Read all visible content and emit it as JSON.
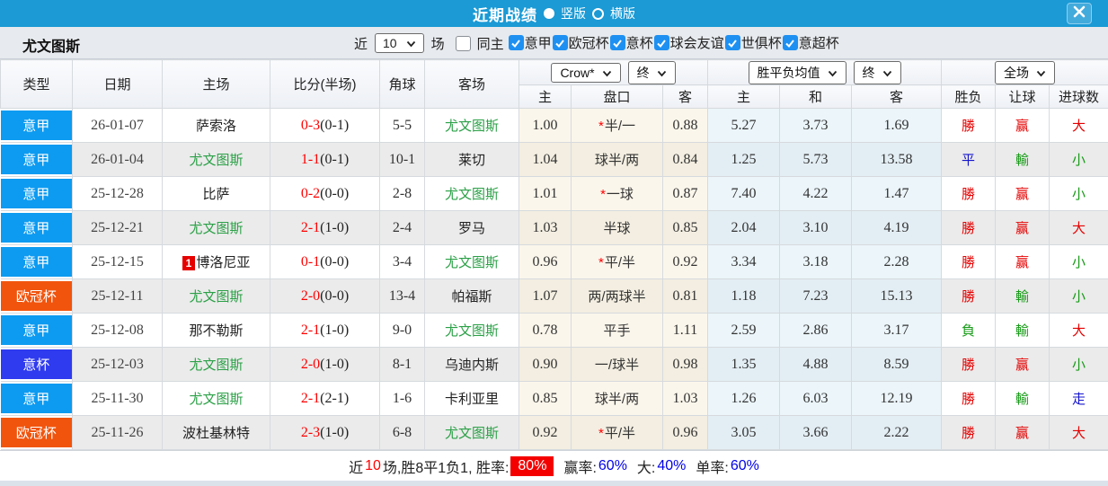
{
  "titlebar": {
    "title": "近期战绩",
    "vertical_label": "竖版",
    "horizontal_label": "横版",
    "vertical_selected": true
  },
  "filterbar": {
    "team": "尤文图斯",
    "near_label": "近",
    "match_count": "10",
    "field_label": "场",
    "same_home_label": "同主",
    "same_home_checked": false,
    "leagues": [
      {
        "label": "意甲",
        "checked": true
      },
      {
        "label": "欧冠杯",
        "checked": true
      },
      {
        "label": "意杯",
        "checked": true
      },
      {
        "label": "球会友谊",
        "checked": true
      },
      {
        "label": "世俱杯",
        "checked": true
      },
      {
        "label": "意超杯",
        "checked": true
      }
    ]
  },
  "table": {
    "headers": {
      "type": "类型",
      "date": "日期",
      "home": "主场",
      "score": "比分(半场)",
      "corner": "角球",
      "away": "客场",
      "sub_odds_home": "主",
      "sub_handicap": "盘口",
      "sub_odds_away": "客",
      "sub_avg_home": "主",
      "sub_avg_draw": "和",
      "sub_avg_away": "客",
      "sub_result": "胜负",
      "sub_handicap_result": "让球",
      "sub_goals": "进球数"
    },
    "dropdowns": {
      "odds_source": "Crow*",
      "final1": "终",
      "avg": "胜平负均值",
      "final2": "终",
      "scope": "全场"
    },
    "rows": [
      {
        "league": "意甲",
        "league_color": "serie_a",
        "date": "26-01-07",
        "home": "萨索洛",
        "home_green": false,
        "home_rank": "",
        "score": "0-3",
        "half": "(0-1)",
        "corner": "5-5",
        "away": "尤文图斯",
        "away_green": true,
        "odds_home": "1.00",
        "handicap": "半/一",
        "handicap_star": true,
        "odds_away": "0.88",
        "avg_home": "5.27",
        "avg_draw": "3.73",
        "avg_away": "1.69",
        "result": "勝",
        "result_color": "red",
        "handicap_result": "赢",
        "handicap_result_color": "red",
        "goals": "大",
        "goals_color": "red"
      },
      {
        "league": "意甲",
        "league_color": "serie_a",
        "date": "26-01-04",
        "home": "尤文图斯",
        "home_green": true,
        "home_rank": "",
        "score": "1-1",
        "half": "(0-1)",
        "corner": "10-1",
        "away": "莱切",
        "away_green": false,
        "odds_home": "1.04",
        "handicap": "球半/两",
        "handicap_star": false,
        "odds_away": "0.84",
        "avg_home": "1.25",
        "avg_draw": "5.73",
        "avg_away": "13.58",
        "result": "平",
        "result_color": "blue",
        "handicap_result": "輸",
        "handicap_result_color": "green",
        "goals": "小",
        "goals_color": "green"
      },
      {
        "league": "意甲",
        "league_color": "serie_a",
        "date": "25-12-28",
        "home": "比萨",
        "home_green": false,
        "home_rank": "",
        "score": "0-2",
        "half": "(0-0)",
        "corner": "2-8",
        "away": "尤文图斯",
        "away_green": true,
        "odds_home": "1.01",
        "handicap": "一球",
        "handicap_star": true,
        "odds_away": "0.87",
        "avg_home": "7.40",
        "avg_draw": "4.22",
        "avg_away": "1.47",
        "result": "勝",
        "result_color": "red",
        "handicap_result": "赢",
        "handicap_result_color": "red",
        "goals": "小",
        "goals_color": "green"
      },
      {
        "league": "意甲",
        "league_color": "serie_a",
        "date": "25-12-21",
        "home": "尤文图斯",
        "home_green": true,
        "home_rank": "",
        "score": "2-1",
        "half": "(1-0)",
        "corner": "2-4",
        "away": "罗马",
        "away_green": false,
        "odds_home": "1.03",
        "handicap": "半球",
        "handicap_star": false,
        "odds_away": "0.85",
        "avg_home": "2.04",
        "avg_draw": "3.10",
        "avg_away": "4.19",
        "result": "勝",
        "result_color": "red",
        "handicap_result": "赢",
        "handicap_result_color": "red",
        "goals": "大",
        "goals_color": "red"
      },
      {
        "league": "意甲",
        "league_color": "serie_a",
        "date": "25-12-15",
        "home": "博洛尼亚",
        "home_green": false,
        "home_rank": "1",
        "score": "0-1",
        "half": "(0-0)",
        "corner": "3-4",
        "away": "尤文图斯",
        "away_green": true,
        "odds_home": "0.96",
        "handicap": "平/半",
        "handicap_star": true,
        "odds_away": "0.92",
        "avg_home": "3.34",
        "avg_draw": "3.18",
        "avg_away": "2.28",
        "result": "勝",
        "result_color": "red",
        "handicap_result": "赢",
        "handicap_result_color": "red",
        "goals": "小",
        "goals_color": "green"
      },
      {
        "league": "欧冠杯",
        "league_color": "ucl",
        "date": "25-12-11",
        "home": "尤文图斯",
        "home_green": true,
        "home_rank": "",
        "score": "2-0",
        "half": "(0-0)",
        "corner": "13-4",
        "away": "帕福斯",
        "away_green": false,
        "odds_home": "1.07",
        "handicap": "两/两球半",
        "handicap_star": false,
        "odds_away": "0.81",
        "avg_home": "1.18",
        "avg_draw": "7.23",
        "avg_away": "15.13",
        "result": "勝",
        "result_color": "red",
        "handicap_result": "輸",
        "handicap_result_color": "green",
        "goals": "小",
        "goals_color": "green"
      },
      {
        "league": "意甲",
        "league_color": "serie_a",
        "date": "25-12-08",
        "home": "那不勒斯",
        "home_green": false,
        "home_rank": "",
        "score": "2-1",
        "half": "(1-0)",
        "corner": "9-0",
        "away": "尤文图斯",
        "away_green": true,
        "odds_home": "0.78",
        "handicap": "平手",
        "handicap_star": false,
        "odds_away": "1.11",
        "avg_home": "2.59",
        "avg_draw": "2.86",
        "avg_away": "3.17",
        "result": "負",
        "result_color": "green",
        "handicap_result": "輸",
        "handicap_result_color": "green",
        "goals": "大",
        "goals_color": "red"
      },
      {
        "league": "意杯",
        "league_color": "coppa",
        "date": "25-12-03",
        "home": "尤文图斯",
        "home_green": true,
        "home_rank": "",
        "score": "2-0",
        "half": "(1-0)",
        "corner": "8-1",
        "away": "乌迪内斯",
        "away_green": false,
        "odds_home": "0.90",
        "handicap": "一/球半",
        "handicap_star": false,
        "odds_away": "0.98",
        "avg_home": "1.35",
        "avg_draw": "4.88",
        "avg_away": "8.59",
        "result": "勝",
        "result_color": "red",
        "handicap_result": "赢",
        "handicap_result_color": "red",
        "goals": "小",
        "goals_color": "green"
      },
      {
        "league": "意甲",
        "league_color": "serie_a",
        "date": "25-11-30",
        "home": "尤文图斯",
        "home_green": true,
        "home_rank": "",
        "score": "2-1",
        "half": "(2-1)",
        "corner": "1-6",
        "away": "卡利亚里",
        "away_green": false,
        "odds_home": "0.85",
        "handicap": "球半/两",
        "handicap_star": false,
        "odds_away": "1.03",
        "avg_home": "1.26",
        "avg_draw": "6.03",
        "avg_away": "12.19",
        "result": "勝",
        "result_color": "red",
        "handicap_result": "輸",
        "handicap_result_color": "green",
        "goals": "走",
        "goals_color": "blue"
      },
      {
        "league": "欧冠杯",
        "league_color": "ucl",
        "date": "25-11-26",
        "home": "波杜基林特",
        "home_green": false,
        "home_rank": "",
        "score": "2-3",
        "half": "(1-0)",
        "corner": "6-8",
        "away": "尤文图斯",
        "away_green": true,
        "odds_home": "0.92",
        "handicap": "平/半",
        "handicap_star": true,
        "odds_away": "0.96",
        "avg_home": "3.05",
        "avg_draw": "3.66",
        "avg_away": "2.22",
        "result": "勝",
        "result_color": "red",
        "handicap_result": "赢",
        "handicap_result_color": "red",
        "goals": "大",
        "goals_color": "red"
      }
    ]
  },
  "footer": {
    "prefix": "近",
    "count": "10",
    "summary": "场,胜8平1负1, 胜率:",
    "win_rate": "80%",
    "win_label": "赢率:",
    "win_pct": "60%",
    "big_label": "大:",
    "big_pct": "40%",
    "single_label": "单率:",
    "single_pct": "60%"
  },
  "colors": {
    "league": {
      "serie_a": "#0d9bf1",
      "ucl": "#f1540d",
      "coppa": "#2f3bee"
    },
    "titlebar": "#1b9ad5",
    "result_red": "#e60000",
    "result_blue": "#1414cc",
    "result_green": "#179a17",
    "team_green": "#2aa046",
    "rate_box": "#f40000"
  }
}
